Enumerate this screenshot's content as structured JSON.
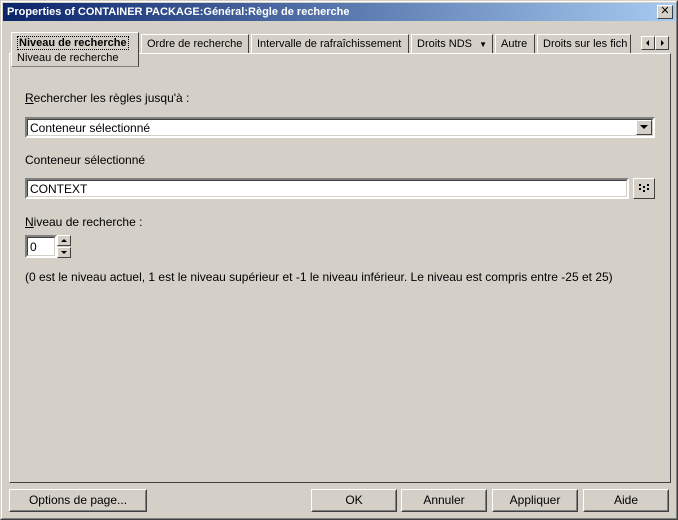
{
  "window": {
    "title": "Properties of CONTAINER PACKAGE:Général:Règle de recherche",
    "close_glyph": "✕"
  },
  "tabs": [
    {
      "label": "Niveau de recherche",
      "sub": "Niveau de recherche"
    },
    {
      "label": "Ordre de recherche"
    },
    {
      "label": "Intervalle de rafraîchissement"
    },
    {
      "label": "Droits NDS",
      "dropdown": "▼"
    },
    {
      "label": "Autre"
    },
    {
      "label": "Droits sur les fich"
    }
  ],
  "form": {
    "search_rules_label_accel": "R",
    "search_rules_label_rest": "echercher les règles jusqu'à :",
    "search_rules_value": "Conteneur sélectionné",
    "selected_container_label": "Conteneur sélectionné",
    "selected_container_value": "CONTEXT",
    "level_label_accel": "N",
    "level_label_rest": "iveau de recherche :",
    "level_value": "0",
    "hint": "(0 est le niveau actuel, 1 est le niveau supérieur et -1 le niveau inférieur. Le niveau est compris entre -25 et 25)"
  },
  "buttons": {
    "page_options": "Options de page...",
    "ok": "OK",
    "cancel": "Annuler",
    "apply": "Appliquer",
    "help": "Aide"
  },
  "icons": {
    "dropdown": "triangle-down-icon",
    "browse": "browse-tree-icon",
    "spin_up": "triangle-up-icon",
    "spin_down": "triangle-down-icon",
    "scroll_left": "triangle-left-icon",
    "scroll_right": "triangle-right-icon"
  },
  "colors": {
    "titlebar_start": "#0a246a",
    "titlebar_end": "#a6caf0",
    "face": "#d4d0c8"
  }
}
